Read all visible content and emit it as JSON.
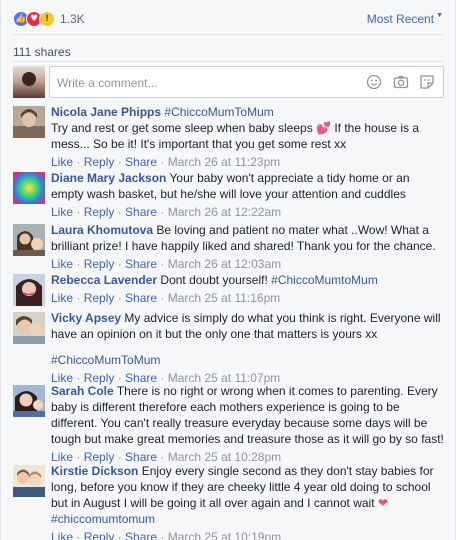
{
  "reactions": {
    "count": "1.3K",
    "types": [
      "like-icon",
      "love-icon",
      "wow-icon"
    ],
    "colors": {
      "like": "#4a72ff",
      "love": "#f0284a",
      "wow": "#f7c530"
    }
  },
  "sort": {
    "label": "Most Recent"
  },
  "shares": {
    "label": "111 shares"
  },
  "composer": {
    "placeholder": "Write a comment..."
  },
  "actions": {
    "like": "Like",
    "reply": "Reply",
    "share": "Share"
  },
  "comments": [
    {
      "name": "Nicola Jane Phipps",
      "text_before": "#ChiccoMumToMum",
      "text": "Try and rest or get some sleep when baby sleeps",
      "emoji": "💕",
      "text_after": " If the house is a mess... So be it! It's important that you get some rest xx",
      "time": "March 26 at 11:23pm"
    },
    {
      "name": "Diane Mary Jackson",
      "text": "Your baby won't appreciate a tidy home or an empty wash basket, but he/she will love your attention and cuddles",
      "time": "March 26 at 12:22am"
    },
    {
      "name": "Laura Khomutova",
      "text": "Be loving and patient no mater what ..Wow! What a brilliant prize! I have happily liked and shared! Thank you for the chance.",
      "time": "March 26 at 12:03am"
    },
    {
      "name": "Rebecca Lavender",
      "text": "Dont doubt yourself!",
      "hashtag": "#ChiccoMumtoMum",
      "time": "March 25 at 11:16pm"
    },
    {
      "name": "Vicky Apsey",
      "text": "My advice is simply do what you think is right. Everyone will have an opinion on it but the only one that matters is yours xx",
      "hashtag": "#ChiccoMumToMum",
      "time": "March 25 at 11:07pm"
    },
    {
      "name": "Sarah Cole",
      "text": "There is no right or wrong when it comes to parenting. Every baby is different therefore each mothers experience is going to be different. You can't really treasure everyday because some days will be tough but make great memories and treasure those as it will go by so fast!",
      "time": "March 25 at 10:28pm"
    },
    {
      "name": "Kirstie Dickson",
      "text": "Enjoy every single second as they don't stay babies for long, before you know if they are cheeky little 4 year old doing to school but in August I will be going it all over again and I cannot wait",
      "emoji": "❤",
      "hashtag": "#chiccomumtomum",
      "time": "March 25 at 10:19pm"
    }
  ]
}
